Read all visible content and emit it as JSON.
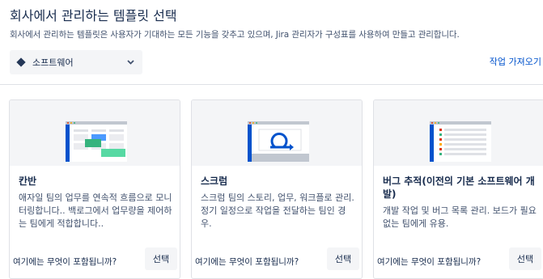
{
  "header": {
    "title": "회사에서 관리하는 템플릿 선택",
    "subtitle": "회사에서 관리하는 템플릿은 사용자가 기대하는 모든 기능을 갖추고 있으며, Jira 관리자가 구성표를 사용하여 만들고 관리합니다."
  },
  "category_select": {
    "value": "소프트웨어",
    "icon": "diamond-icon"
  },
  "import_link": "작업 가져오기",
  "cards": [
    {
      "name": "칸반",
      "desc": "애자일 팀의 업무를 연속적 흐름으로 모니터링합니다.. 백로그에서 업무량을 제어하는 팀에게 적합합니다..",
      "question": "여기에는 무엇이 포함됩니까?",
      "button": "선택"
    },
    {
      "name": "스크럼",
      "desc": "스크럼 팀의 스토리, 업무, 워크플로 관리. 정기 일정으로 작업을 전달하는 팀인 경우.",
      "question": "여기에는 무엇이 포함됩니까?",
      "button": "선택"
    },
    {
      "name": "버그 추적(이전의 기본 소프트웨어 개발)",
      "desc": "개발 작업 및 버그 목록 관리. 보드가 필요 없는 팀에게 유용.",
      "question": "여기에는 무엇이 포함됩니까?",
      "button": "선택"
    }
  ],
  "colors": {
    "accent": "#0052cc",
    "text": "#172b4d",
    "muted": "#42526e",
    "panel": "#f4f5f7"
  }
}
